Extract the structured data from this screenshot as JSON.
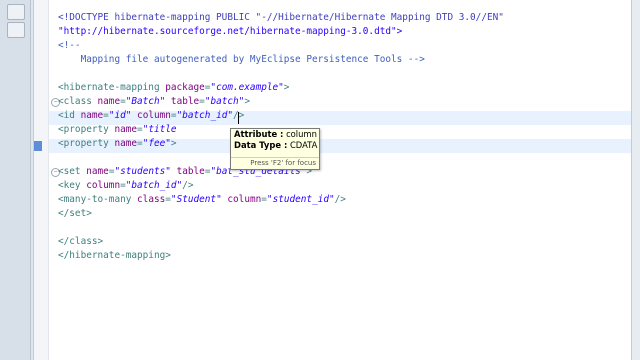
{
  "editor": {
    "lines": [
      {
        "doctype": "<!DOCTYPE hibernate-mapping PUBLIC \"-//Hibernate/Hibernate Mapping DTD 3.0//EN\""
      },
      {
        "string": "\"http://hibernate.sourceforge.net/hibernate-mapping-3.0.dtd\">"
      },
      {
        "comment": "<!--"
      },
      {
        "comment": "    Mapping file autogenerated by MyEclipse Persistence Tools -->"
      },
      {
        "blank": ""
      },
      {
        "open": "<hibernate-mapping ",
        "a1": "package",
        "eq1": "=",
        "v1": "\"com.example\"",
        "close": ">"
      },
      {
        "open": "<class ",
        "a1": "name",
        "eq1": "=",
        "v1": "\"Batch\"",
        "sp": " ",
        "a2": "table",
        "eq2": "=",
        "v2": "\"batch\"",
        "close": ">"
      },
      {
        "open": "<id ",
        "a1": "name",
        "eq1": "=",
        "v1": "\"id\"",
        "sp": " ",
        "a2": "column",
        "eq2": "=",
        "v2": "\"batch_id\"",
        "close": "/>"
      },
      {
        "open": "<property ",
        "a1": "name",
        "eq1": "=",
        "v1": "\"title"
      },
      {
        "open": "<property ",
        "a1": "name",
        "eq1": "=",
        "v1": "\"fee\"",
        "close": ">"
      },
      {
        "blank": ""
      },
      {
        "open": "<set ",
        "a1": "name",
        "eq1": "=",
        "v1": "\"students\"",
        "sp": " ",
        "a2": "table",
        "eq2": "=",
        "v2": "\"bat_stu_details\"",
        "close": ">"
      },
      {
        "open": "<key ",
        "a1": "column",
        "eq1": "=",
        "v1": "\"batch_id\"",
        "close": "/>"
      },
      {
        "open": "<many-to-many ",
        "a1": "class",
        "eq1": "=",
        "v1": "\"Student\"",
        "sp": " ",
        "a2": "column",
        "eq2": "=",
        "v2": "\"student_id\"",
        "close": "/>"
      },
      {
        "open": "</set>"
      },
      {
        "blank": ""
      },
      {
        "open": "</class>"
      },
      {
        "open": "</hibernate-mapping>"
      }
    ]
  },
  "tooltip": {
    "attribute_key": "Attribute :",
    "attribute_value": " column",
    "datatype_key": "Data Type :",
    "datatype_value": " CDATA",
    "footer": "Press 'F2' for focus"
  },
  "colors": {
    "tag": "#3f7f7f",
    "attribute": "#7f007f",
    "value": "#2a00ff",
    "comment": "#3f5fbf"
  }
}
